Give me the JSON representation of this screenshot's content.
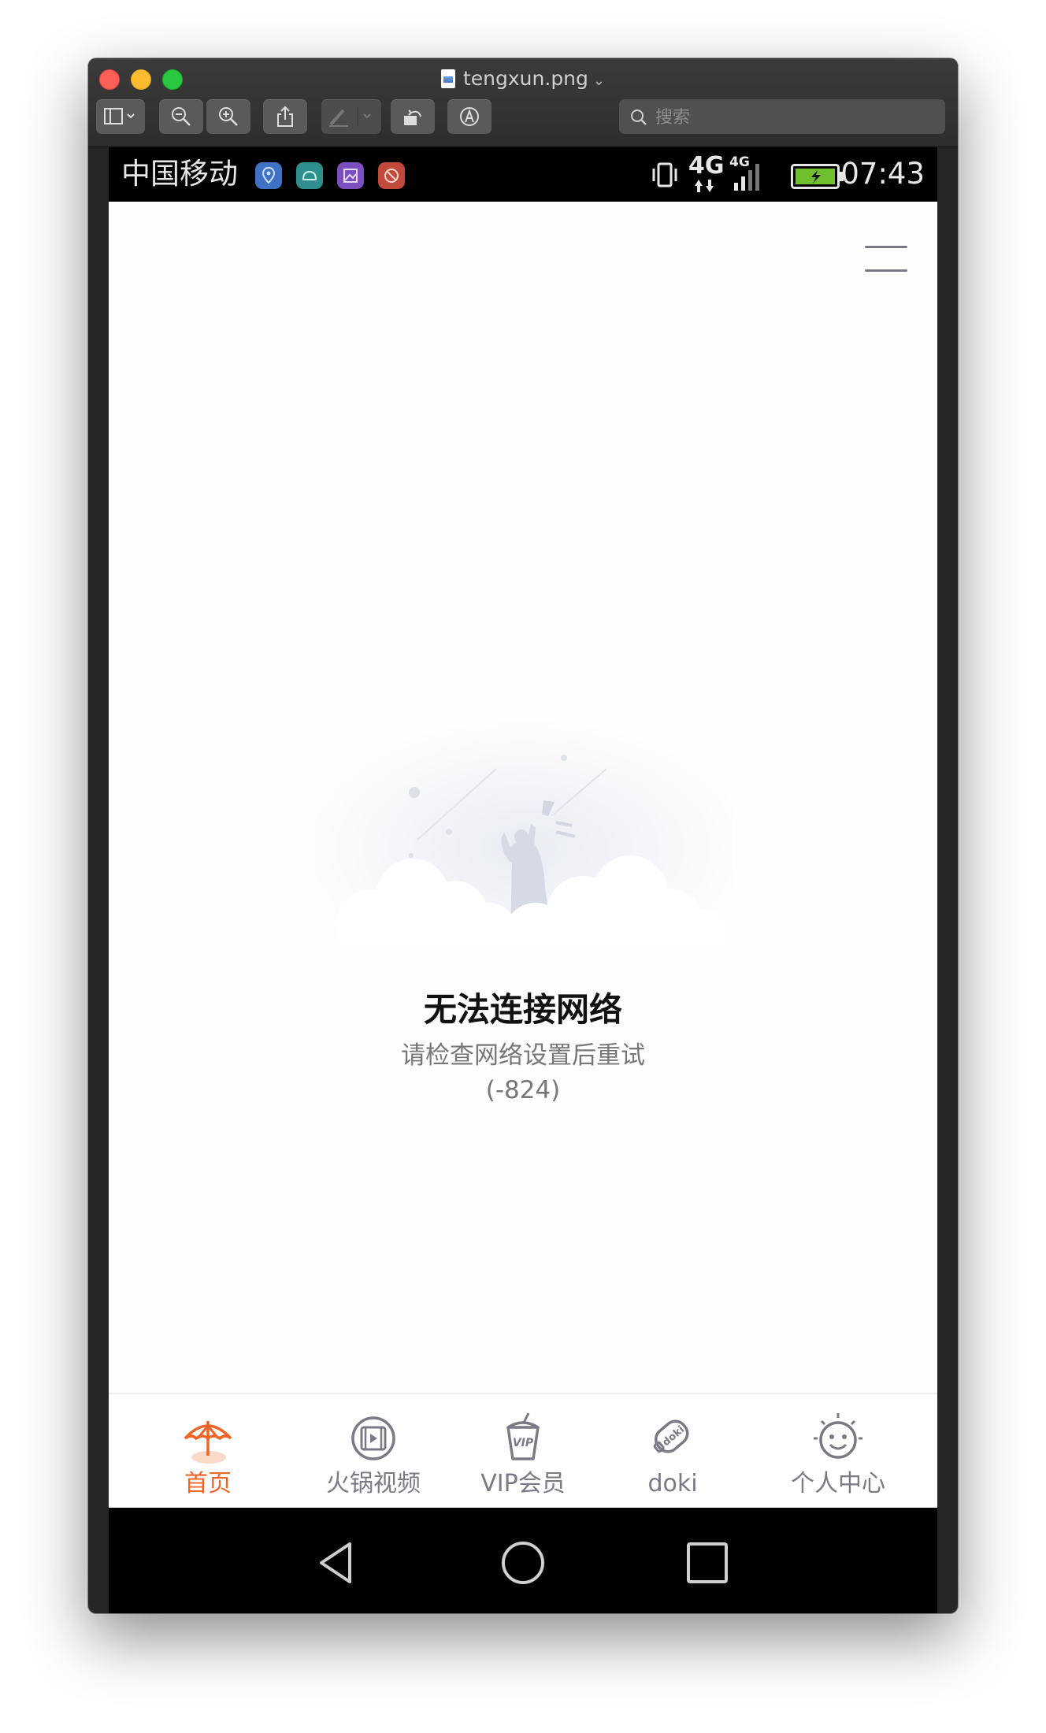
{
  "window": {
    "title": "tengxun.png",
    "search_placeholder": "搜索"
  },
  "statusbar": {
    "carrier": "中国移动",
    "network_a": "4G",
    "network_b": "4G",
    "time": "07:43"
  },
  "error": {
    "title": "无法连接网络",
    "subtitle": "请检查网络设置后重试",
    "code": "(-824)"
  },
  "tabbar": {
    "tabs": [
      {
        "label": "首页",
        "active": true,
        "icon": "umbrella-icon"
      },
      {
        "label": "火锅视频",
        "active": false,
        "icon": "film-icon"
      },
      {
        "label": "VIP会员",
        "active": false,
        "icon": "vip-cup-icon"
      },
      {
        "label": "doki",
        "active": false,
        "icon": "doki-popsicle-icon"
      },
      {
        "label": "个人中心",
        "active": false,
        "icon": "smiley-icon"
      }
    ]
  },
  "colors": {
    "accent": "#f06426",
    "inactive": "#7a7a86"
  }
}
